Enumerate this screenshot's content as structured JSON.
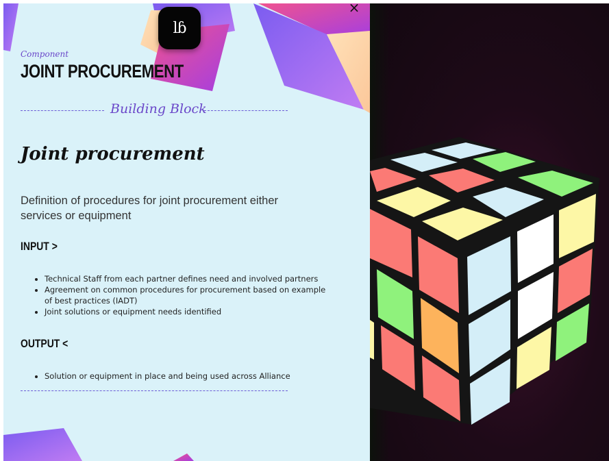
{
  "close_icon": "x",
  "logo_text": "lɓ",
  "kicker": "Component",
  "title": "JOINT PROCUREMENT",
  "building_block_label": "Building Block",
  "heading": "Joint procurement",
  "description": "Definition of procedures for joint procurement either services or equipment",
  "input": {
    "label": "INPUT >",
    "items": [
      "Technical Staff from each partner defines need and involved partners",
      "Agreement on common procedures for procurement based on example of best practices (IADT)",
      "Joint solutions or equipment needs identified"
    ]
  },
  "output": {
    "label": "OUTPUT <",
    "items": [
      "Solution or equipment in place and being used across Alliance"
    ]
  },
  "colors": {
    "panel_bg": "#daf2f9",
    "accent": "#6a47c9",
    "cube_red": "#fb7a75",
    "cube_green": "#8ff27c",
    "cube_yellow": "#fdf7a6",
    "cube_blue": "#d4eef8",
    "cube_orange": "#fdb35c",
    "cube_white": "#ffffff"
  }
}
